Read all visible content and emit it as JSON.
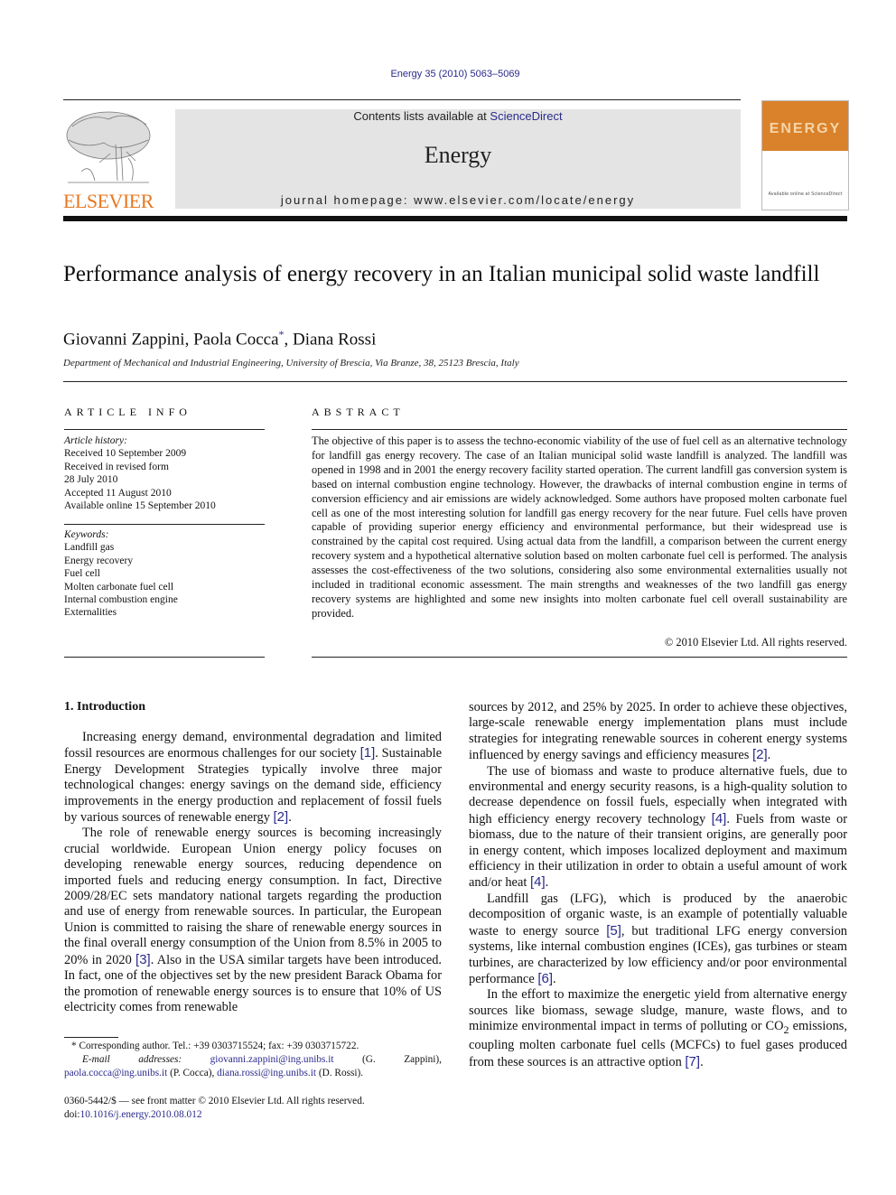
{
  "header": {
    "journal_ref": "Energy 35 (2010) 5063–5069",
    "contents_prefix": "Contents lists available at ",
    "contents_link": "ScienceDirect",
    "journal_name": "Energy",
    "homepage": "journal homepage: www.elsevier.com/locate/energy",
    "publisher_logo_text": "ELSEVIER",
    "cover_title": "ENERGY",
    "cover_footer": "Available online at ScienceDirect"
  },
  "colors": {
    "link": "#2a2a8c",
    "elsevier_orange": "#e87722",
    "masthead_gray": "#e4e4e4",
    "cover_orange": "#d9822b"
  },
  "article": {
    "title": "Performance analysis of energy recovery in an Italian municipal solid waste landfill",
    "authors": [
      {
        "name": "Giovanni Zappini",
        "mark": ""
      },
      {
        "name": "Paola Cocca",
        "mark": "*"
      },
      {
        "name": "Diana Rossi",
        "mark": ""
      }
    ],
    "author_sep": ", ",
    "affiliation": "Department of Mechanical and Industrial Engineering, University of Brescia, Via Branze, 38, 25123 Brescia, Italy"
  },
  "article_info": {
    "heading": "ARTICLE INFO",
    "history_label": "Article history:",
    "history": [
      "Received 10 September 2009",
      "Received in revised form",
      "28 July 2010",
      "Accepted 11 August 2010",
      "Available online 15 September 2010"
    ],
    "keywords_label": "Keywords:",
    "keywords": [
      "Landfill gas",
      "Energy recovery",
      "Fuel cell",
      "Molten carbonate fuel cell",
      "Internal combustion engine",
      "Externalities"
    ]
  },
  "abstract": {
    "heading": "ABSTRACT",
    "text": "The objective of this paper is to assess the techno-economic viability of the use of fuel cell as an alternative technology for landfill gas energy recovery. The case of an Italian municipal solid waste landfill is analyzed. The landfill was opened in 1998 and in 2001 the energy recovery facility started operation. The current landfill gas conversion system is based on internal combustion engine technology. However, the drawbacks of internal combustion engine in terms of conversion efficiency and air emissions are widely acknowledged. Some authors have proposed molten carbonate fuel cell as one of the most interesting solution for landfill gas energy recovery for the near future. Fuel cells have proven capable of providing superior energy efficiency and environmental performance, but their widespread use is constrained by the capital cost required. Using actual data from the landfill, a comparison between the current energy recovery system and a hypothetical alternative solution based on molten carbonate fuel cell is performed. The analysis assesses the cost-effectiveness of the two solutions, considering also some environmental externalities usually not included in traditional economic assessment. The main strengths and weaknesses of the two landfill gas energy recovery systems are highlighted and some new insights into molten carbonate fuel cell overall sustainability are provided.",
    "copyright": "© 2010 Elsevier Ltd. All rights reserved."
  },
  "body": {
    "section_heading": "1.  Introduction",
    "left_paragraphs": [
      {
        "parts": [
          {
            "t": "Increasing energy demand, environmental degradation and limited fossil resources are enormous challenges for our society "
          },
          {
            "c": "[1]"
          },
          {
            "t": ". Sustainable Energy Development Strategies typically involve three major technological changes: energy savings on the demand side, efficiency improvements in the energy production and replacement of fossil fuels by various sources of renewable energy "
          },
          {
            "c": "[2]"
          },
          {
            "t": "."
          }
        ]
      },
      {
        "parts": [
          {
            "t": "The role of renewable energy sources is becoming increasingly crucial worldwide. European Union energy policy focuses on developing renewable energy sources, reducing dependence on imported fuels and reducing energy consumption. In fact, Directive 2009/28/EC sets mandatory national targets regarding the production and use of energy from renewable sources. In particular, the European Union is committed to raising the share of renewable energy sources in the final overall energy consumption of the Union from 8.5% in 2005 to 20% in 2020 "
          },
          {
            "c": "[3]"
          },
          {
            "t": ". Also in the USA similar targets have been introduced. In fact, one of the objectives set by the new president Barack Obama for the promotion of renewable energy sources is to ensure that 10% of US electricity comes from renewable"
          }
        ]
      }
    ],
    "right_paragraphs": [
      {
        "noindent": true,
        "parts": [
          {
            "t": "sources by 2012, and 25% by 2025. In order to achieve these objectives, large-scale renewable energy implementation plans must include strategies for integrating renewable sources in coherent energy systems influenced by energy savings and efficiency measures "
          },
          {
            "c": "[2]"
          },
          {
            "t": "."
          }
        ]
      },
      {
        "parts": [
          {
            "t": "The use of biomass and waste to produce alternative fuels, due to environmental and energy security reasons, is a high-quality solution to decrease dependence on fossil fuels, especially when integrated with high efficiency energy recovery technology "
          },
          {
            "c": "[4]"
          },
          {
            "t": ". Fuels from waste or biomass, due to the nature of their transient origins, are generally poor in energy content, which imposes localized deployment and maximum efficiency in their utilization in order to obtain a useful amount of work and/or heat "
          },
          {
            "c": "[4]"
          },
          {
            "t": "."
          }
        ]
      },
      {
        "parts": [
          {
            "t": "Landfill gas (LFG), which is produced by the anaerobic decomposition of organic waste, is an example of potentially valuable waste to energy source "
          },
          {
            "c": "[5]"
          },
          {
            "t": ", but traditional LFG energy conversion systems, like internal combustion engines (ICEs), gas turbines or steam turbines, are characterized by low efficiency and/or poor environmental performance "
          },
          {
            "c": "[6]"
          },
          {
            "t": "."
          }
        ]
      },
      {
        "parts": [
          {
            "t": "In the effort to maximize the energetic yield from alternative energy sources like biomass, sewage sludge, manure, waste flows, and to minimize environmental impact in terms of polluting or CO"
          },
          {
            "sub": "2"
          },
          {
            "t": " emissions, coupling molten carbonate fuel cells (MCFCs) to fuel gases produced from these sources is an attractive option "
          },
          {
            "c": "[7]"
          },
          {
            "t": "."
          }
        ]
      }
    ]
  },
  "footnotes": {
    "corresponding": "* Corresponding author. Tel.: +39 0303715524; fax: +39 0303715722.",
    "email_label": "E-mail addresses:",
    "emails": [
      {
        "addr": "giovanni.zappini@ing.unibs.it",
        "who": " (G. Zappini), "
      },
      {
        "addr": "paola.cocca@ing.unibs.it",
        "who": " (P. Cocca), "
      },
      {
        "addr": "diana.rossi@ing.unibs.it",
        "who": " (D. Rossi)."
      }
    ],
    "front_matter": "0360-5442/$ — see front matter © 2010 Elsevier Ltd. All rights reserved.",
    "doi_prefix": "doi:",
    "doi": "10.1016/j.energy.2010.08.012"
  }
}
